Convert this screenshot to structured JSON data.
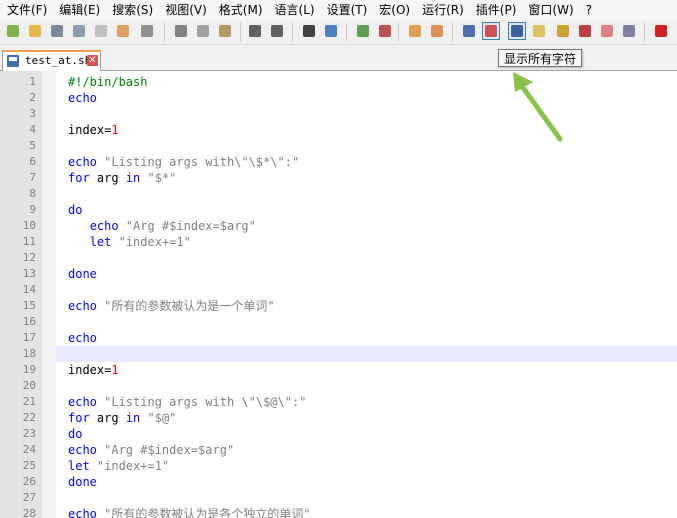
{
  "menu": [
    "文件(F)",
    "编辑(E)",
    "搜索(S)",
    "视图(V)",
    "格式(M)",
    "语言(L)",
    "设置(T)",
    "宏(O)",
    "运行(R)",
    "插件(P)",
    "窗口(W)",
    "?"
  ],
  "toolbar": {
    "buttons": [
      {
        "name": "new-file-icon",
        "color": "#7fb24a"
      },
      {
        "name": "open-file-icon",
        "color": "#e8b84a"
      },
      {
        "name": "save-icon",
        "color": "#7a8aa0"
      },
      {
        "name": "save-all-icon",
        "color": "#8f9bb0"
      },
      {
        "name": "close-file-icon",
        "color": "#c0c0c0"
      },
      {
        "name": "close-all-icon",
        "color": "#e0a060"
      },
      {
        "name": "print-icon",
        "color": "#909090"
      },
      {
        "name": "cut-icon",
        "color": "#808080"
      },
      {
        "name": "copy-icon",
        "color": "#a0a0a0"
      },
      {
        "name": "paste-icon",
        "color": "#b89a60"
      },
      {
        "name": "undo-icon",
        "color": "#606060"
      },
      {
        "name": "redo-icon",
        "color": "#606060"
      },
      {
        "name": "find-icon",
        "color": "#404040"
      },
      {
        "name": "replace-icon",
        "color": "#4a7fc0"
      },
      {
        "name": "zoom-in-icon",
        "color": "#5aa050"
      },
      {
        "name": "zoom-out-icon",
        "color": "#c05050"
      },
      {
        "name": "sync-vertical-icon",
        "color": "#e0a050"
      },
      {
        "name": "sync-horizontal-icon",
        "color": "#e09050"
      },
      {
        "name": "word-wrap-icon",
        "color": "#4a70b0"
      },
      {
        "name": "show-all-chars-icon",
        "color": "#d05050"
      },
      {
        "name": "indent-guide-icon",
        "color": "#3a60a0"
      },
      {
        "name": "user-language-icon",
        "color": "#e0c060"
      },
      {
        "name": "document-map-icon",
        "color": "#d0a030"
      },
      {
        "name": "function-list-icon",
        "color": "#c04040"
      },
      {
        "name": "folder-workspace-icon",
        "color": "#e08080"
      },
      {
        "name": "monitoring-icon",
        "color": "#8080a0"
      },
      {
        "name": "record-macro-icon",
        "color": "#d02020"
      }
    ],
    "tooltip": "显示所有字符"
  },
  "colors": {
    "tab_accent": "#f6a04d",
    "arrow": "#8bc34a",
    "keyword": "#0000ff",
    "string": "#808080",
    "number": "#ff0000",
    "comment": "#008000"
  },
  "tab": {
    "label": "test_at.sh",
    "close_glyph": "✕"
  },
  "editor": {
    "current_line": 18,
    "lines": [
      {
        "n": "1",
        "tokens": [
          {
            "t": "#!/bin/bash",
            "c": "shebang"
          }
        ]
      },
      {
        "n": "2",
        "tokens": [
          {
            "t": "echo",
            "c": "kw"
          }
        ]
      },
      {
        "n": "3",
        "tokens": []
      },
      {
        "n": "4",
        "tokens": [
          {
            "t": "index=",
            "c": "txt"
          },
          {
            "t": "1",
            "c": "num"
          }
        ]
      },
      {
        "n": "5",
        "tokens": []
      },
      {
        "n": "6",
        "tokens": [
          {
            "t": "echo",
            "c": "kw"
          },
          {
            "t": " \"Listing args with\\\"\\$*\\\":\"",
            "c": "str"
          }
        ]
      },
      {
        "n": "7",
        "tokens": [
          {
            "t": "for",
            "c": "kw"
          },
          {
            "t": " arg ",
            "c": "txt"
          },
          {
            "t": "in",
            "c": "kw"
          },
          {
            "t": " \"$*\"",
            "c": "str"
          }
        ]
      },
      {
        "n": "8",
        "tokens": []
      },
      {
        "n": "9",
        "tokens": [
          {
            "t": "do",
            "c": "kw"
          }
        ]
      },
      {
        "n": "10",
        "tokens": [
          {
            "t": "   ",
            "c": "txt"
          },
          {
            "t": "echo",
            "c": "kw"
          },
          {
            "t": " \"Arg #$index=$arg\"",
            "c": "str"
          }
        ]
      },
      {
        "n": "11",
        "tokens": [
          {
            "t": "   ",
            "c": "txt"
          },
          {
            "t": "let",
            "c": "kw"
          },
          {
            "t": " \"index+=1\"",
            "c": "str"
          }
        ]
      },
      {
        "n": "12",
        "tokens": []
      },
      {
        "n": "13",
        "tokens": [
          {
            "t": "done",
            "c": "kw"
          }
        ]
      },
      {
        "n": "14",
        "tokens": []
      },
      {
        "n": "15",
        "tokens": [
          {
            "t": "echo",
            "c": "kw"
          },
          {
            "t": " \"所有的参数被认为是一个单词\"",
            "c": "str"
          }
        ]
      },
      {
        "n": "16",
        "tokens": []
      },
      {
        "n": "17",
        "tokens": [
          {
            "t": "echo",
            "c": "kw"
          }
        ]
      },
      {
        "n": "18",
        "tokens": []
      },
      {
        "n": "19",
        "tokens": [
          {
            "t": "index=",
            "c": "txt"
          },
          {
            "t": "1",
            "c": "num"
          }
        ]
      },
      {
        "n": "20",
        "tokens": []
      },
      {
        "n": "21",
        "tokens": [
          {
            "t": "echo",
            "c": "kw"
          },
          {
            "t": " \"Listing args with \\\"\\$@\\\":\"",
            "c": "str"
          }
        ]
      },
      {
        "n": "22",
        "tokens": [
          {
            "t": "for",
            "c": "kw"
          },
          {
            "t": " arg ",
            "c": "txt"
          },
          {
            "t": "in",
            "c": "kw"
          },
          {
            "t": " \"$@\"",
            "c": "str"
          }
        ]
      },
      {
        "n": "23",
        "tokens": [
          {
            "t": "do",
            "c": "kw"
          }
        ]
      },
      {
        "n": "24",
        "tokens": [
          {
            "t": "echo",
            "c": "kw"
          },
          {
            "t": " \"Arg #$index=$arg\"",
            "c": "str"
          }
        ]
      },
      {
        "n": "25",
        "tokens": [
          {
            "t": "let",
            "c": "kw"
          },
          {
            "t": " \"index+=1\"",
            "c": "str"
          }
        ]
      },
      {
        "n": "26",
        "tokens": [
          {
            "t": "done",
            "c": "kw"
          }
        ]
      },
      {
        "n": "27",
        "tokens": []
      },
      {
        "n": "28",
        "tokens": [
          {
            "t": "echo",
            "c": "kw"
          },
          {
            "t": " \"所有的参数被认为是各个独立的单词\"",
            "c": "str"
          }
        ]
      }
    ]
  }
}
